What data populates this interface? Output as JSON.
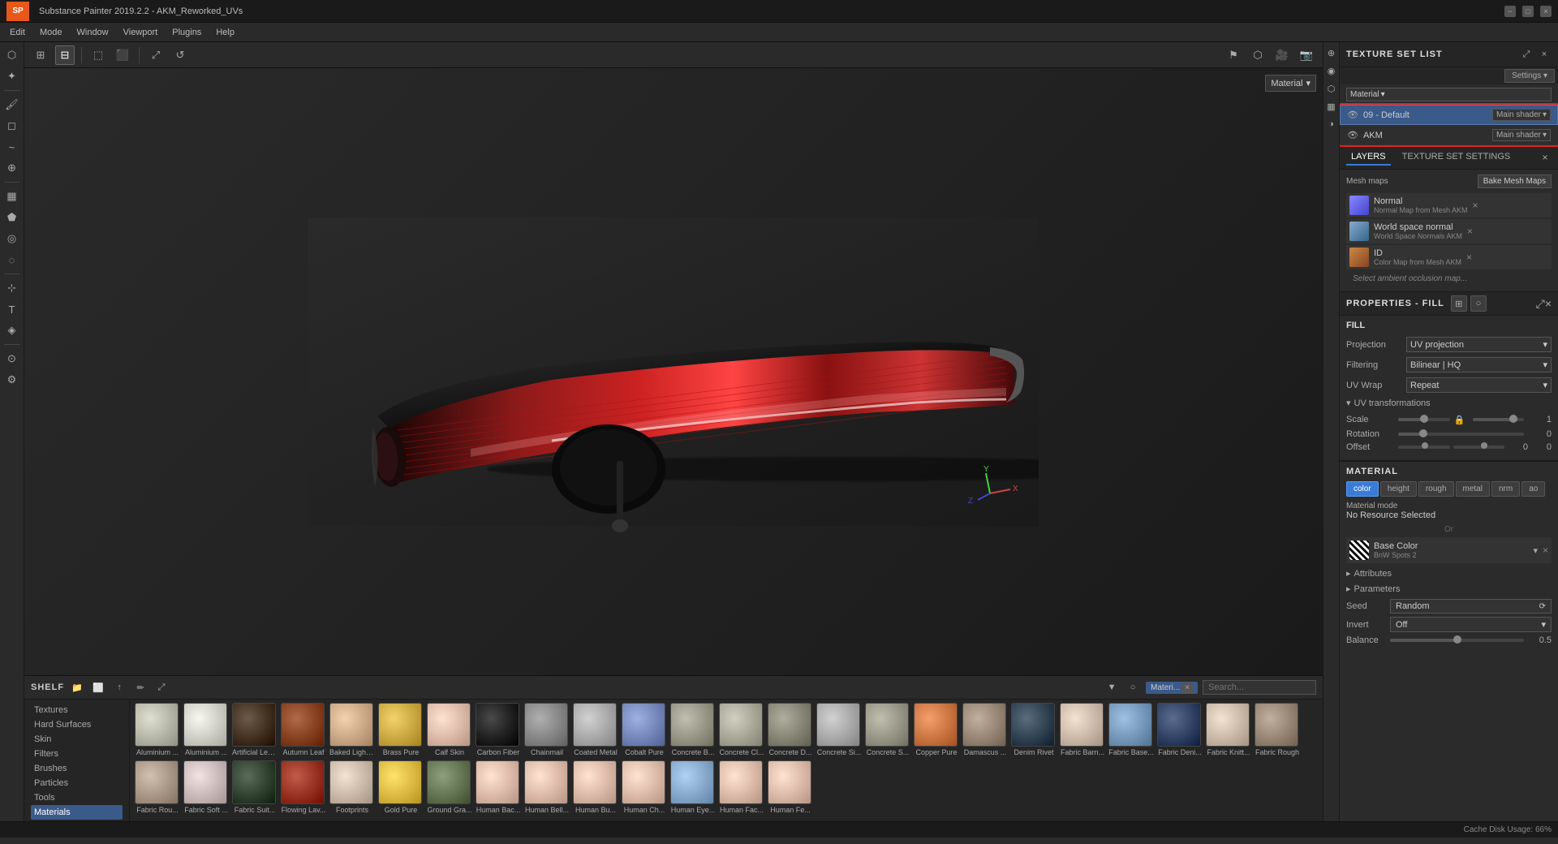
{
  "window": {
    "title": "Substance Painter 2019.2.2 - AKM_Reworked_UVs",
    "min_label": "−",
    "max_label": "□",
    "close_label": "×"
  },
  "menu": {
    "items": [
      "Edit",
      "Mode",
      "Window",
      "Viewport",
      "Plugins",
      "Help"
    ]
  },
  "toolbar_top": {
    "buttons": [
      "grid-sm",
      "grid-lg",
      "split-h",
      "split-v",
      "expand",
      "rotate"
    ]
  },
  "viewport": {
    "material_dropdown": "Material",
    "dropdown_icon": "▾"
  },
  "texture_set_list": {
    "title": "TEXTURE SET LIST",
    "settings_btn": "Settings ▾",
    "material_dropdown": "Material",
    "rows": [
      {
        "name": "09 - Default",
        "shader": "Main shader",
        "selected": true
      },
      {
        "name": "AKM",
        "shader": "Main shader",
        "selected": false
      }
    ]
  },
  "layers": {
    "tab_layers": "LAYERS",
    "tab_texture_settings": "TEXTURE SET SETTINGS",
    "mesh_maps_label": "Mesh maps",
    "bake_btn": "Bake Mesh Maps",
    "maps": [
      {
        "name": "Normal",
        "sub": "Normal Map from Mesh AKM",
        "color": "#7777ff"
      },
      {
        "name": "World space normal",
        "sub": "World Space Normals AKM",
        "color": "#88aacc"
      },
      {
        "name": "ID",
        "sub": "Color Map from Mesh AKM",
        "color": "#cc8844"
      }
    ],
    "ambient_label": "Select ambient occlusion map..."
  },
  "properties": {
    "title": "PROPERTIES - FILL",
    "fill_label": "FILL",
    "projection_label": "Projection",
    "projection_value": "UV projection",
    "filtering_label": "Filtering",
    "filtering_value": "Bilinear | HQ",
    "uv_wrap_label": "UV Wrap",
    "uv_wrap_value": "Repeat",
    "uv_transform_label": "UV transformations",
    "scale_label": "Scale",
    "scale_value": 1,
    "rotation_label": "Rotation",
    "rotation_value": 0,
    "offset_label": "Offset",
    "offset_value_x": 0,
    "offset_value_y": 0
  },
  "material": {
    "title": "MATERIAL",
    "tabs": [
      "color",
      "height",
      "rough",
      "metal",
      "nrm",
      "ao"
    ],
    "active_tab": "color",
    "mode_label": "Material mode",
    "mode_value": "No Resource Selected",
    "or_text": "Or",
    "base_color_label": "Base Color",
    "base_color_name": "BnW Spots 2",
    "attributes_label": "Attributes",
    "parameters_label": "Parameters",
    "seed_label": "Seed",
    "seed_value": "Random",
    "invert_label": "Invert",
    "invert_value": "Off",
    "balance_label": "Balance",
    "balance_value": "0.5"
  },
  "shelf": {
    "title": "SHELF",
    "nav_items": [
      "Textures",
      "Hard Surfaces",
      "Skin",
      "Filters",
      "Brushes",
      "Particles",
      "Tools",
      "Materials"
    ],
    "active_nav": "Materials",
    "filter_label": "Materi...",
    "search_placeholder": "Search...",
    "materials": [
      {
        "label": "Aluminium ...",
        "color": "#b8b8aa"
      },
      {
        "label": "Aluminium ...",
        "color": "#d0d0c8"
      },
      {
        "label": "Artificial Lea...",
        "color": "#443322"
      },
      {
        "label": "Autumn Leaf",
        "color": "#884422"
      },
      {
        "label": "Baked Light ...",
        "color": "#ccaa88"
      },
      {
        "label": "Brass Pure",
        "color": "#ccaa44"
      },
      {
        "label": "Calf Skin",
        "color": "#ddbbaa"
      },
      {
        "label": "Carbon Fiber",
        "color": "#222222"
      },
      {
        "label": "Chainmail",
        "color": "#888888"
      },
      {
        "label": "Coated Metal",
        "color": "#aaaaaa"
      },
      {
        "label": "Cobalt Pure",
        "color": "#7788bb"
      },
      {
        "label": "Concrete B...",
        "color": "#999888"
      },
      {
        "label": "Concrete Cl...",
        "color": "#aaa999"
      },
      {
        "label": "Concrete D...",
        "color": "#888777"
      },
      {
        "label": "Concrete Si...",
        "color": "#aaaaaa"
      },
      {
        "label": "Concrete S...",
        "color": "#999888"
      },
      {
        "label": "Copper Pure",
        "color": "#cc7744"
      },
      {
        "label": "Damascus ...",
        "color": "#998877"
      },
      {
        "label": "Denim Rivet",
        "color": "#334455"
      },
      {
        "label": "Fabric Barn...",
        "color": "#ccbbaa"
      },
      {
        "label": "Fabric Base...",
        "color": "#7799bb"
      },
      {
        "label": "Fabric Deni...",
        "color": "#334466"
      },
      {
        "label": "Fabric Knitt...",
        "color": "#ccbbaa"
      },
      {
        "label": "Fabric Rough",
        "color": "#998877"
      },
      {
        "label": "Fabric Rou...",
        "color": "#aa9988"
      },
      {
        "label": "Fabric Soft ...",
        "color": "#ccbbbb"
      },
      {
        "label": "Fabric Suit...",
        "color": "#334433"
      },
      {
        "label": "Flowing Lav...",
        "color": "#993322"
      },
      {
        "label": "Footprints",
        "color": "#ccbbaa"
      },
      {
        "label": "Gold Pure",
        "color": "#ddbb44"
      },
      {
        "label": "Ground Gra...",
        "color": "#667755"
      },
      {
        "label": "Human Bac...",
        "color": "#ddbbaa"
      },
      {
        "label": "Human Bell...",
        "color": "#ddbbaa"
      },
      {
        "label": "Human Bu...",
        "color": "#ddbbaa"
      },
      {
        "label": "Human Ch...",
        "color": "#ddbbaa"
      },
      {
        "label": "Human Eye...",
        "color": "#88aacc"
      },
      {
        "label": "Human Fac...",
        "color": "#ddbbaa"
      },
      {
        "label": "Human Fe...",
        "color": "#ddbbaa"
      }
    ]
  },
  "status_bar": {
    "cache": "Cache Disk Usage: 66%"
  },
  "icons": {
    "eye": "👁",
    "close": "×",
    "chevron_down": "▾",
    "chevron_right": "▸",
    "lock": "🔒",
    "grid": "⊞",
    "folder": "📁",
    "plus": "+",
    "settings": "⚙",
    "expand": "⤢",
    "arrow_down": "▾"
  }
}
